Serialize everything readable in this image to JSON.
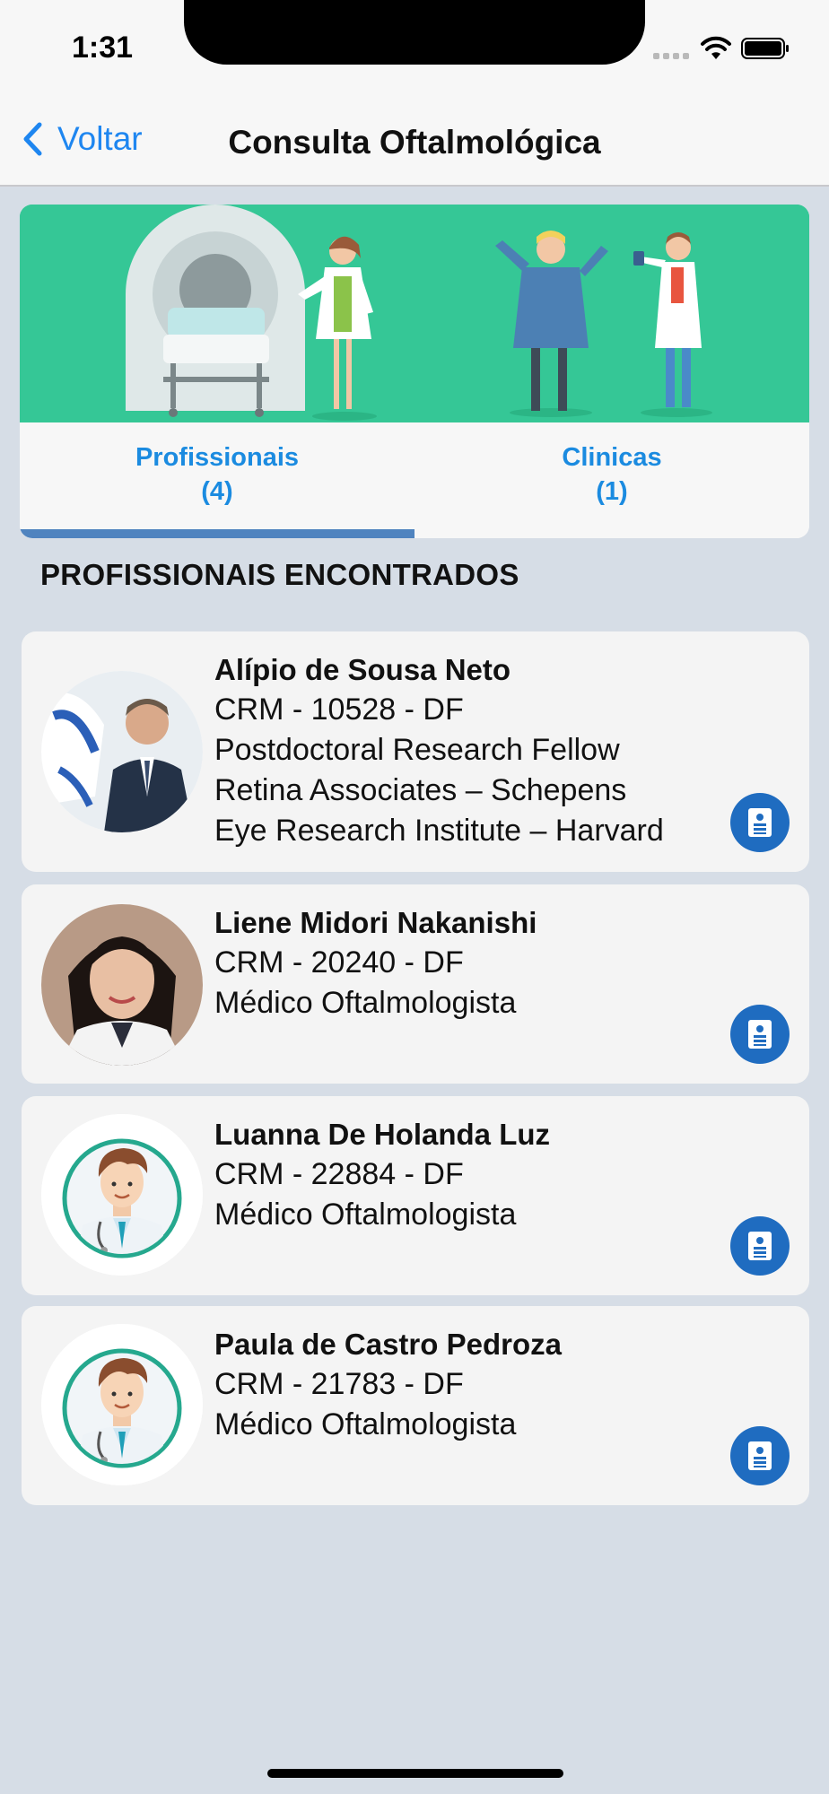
{
  "status_bar": {
    "time": "1:31"
  },
  "nav": {
    "back_label": "Voltar",
    "title": "Consulta Oftalmológica"
  },
  "tabs": [
    {
      "label": "Profissionais",
      "count": "(4)",
      "selected": true
    },
    {
      "label": "Clinicas",
      "count": "(1)",
      "selected": false
    }
  ],
  "section_title": "PROFISSIONAIS ENCONTRADOS",
  "professionals": [
    {
      "name": "Alípio de Sousa Neto",
      "crm": "CRM - 10528 - DF",
      "lines": [
        "Postdoctoral Research Fellow",
        "Retina Associates – Schepens",
        "Eye Research Institute – Harvard"
      ],
      "avatar": "photo-man-suit"
    },
    {
      "name": "Liene Midori Nakanishi",
      "crm": "CRM - 20240 - DF",
      "lines": [
        "Médico Oftalmologista"
      ],
      "avatar": "photo-woman-doctor"
    },
    {
      "name": "Luanna De Holanda Luz",
      "crm": "CRM - 22884 - DF",
      "lines": [
        "Médico Oftalmologista"
      ],
      "avatar": "doctor-placeholder-icon"
    },
    {
      "name": "Paula de Castro Pedroza",
      "crm": "CRM - 21783 - DF",
      "lines": [
        "Médico Oftalmologista"
      ],
      "avatar": "doctor-placeholder-icon"
    }
  ],
  "colors": {
    "accent": "#1e86f0",
    "banner": "#35c796",
    "badge": "#1f6cc0",
    "tab_indicator": "#4f83bf",
    "background": "#d6dde6"
  }
}
